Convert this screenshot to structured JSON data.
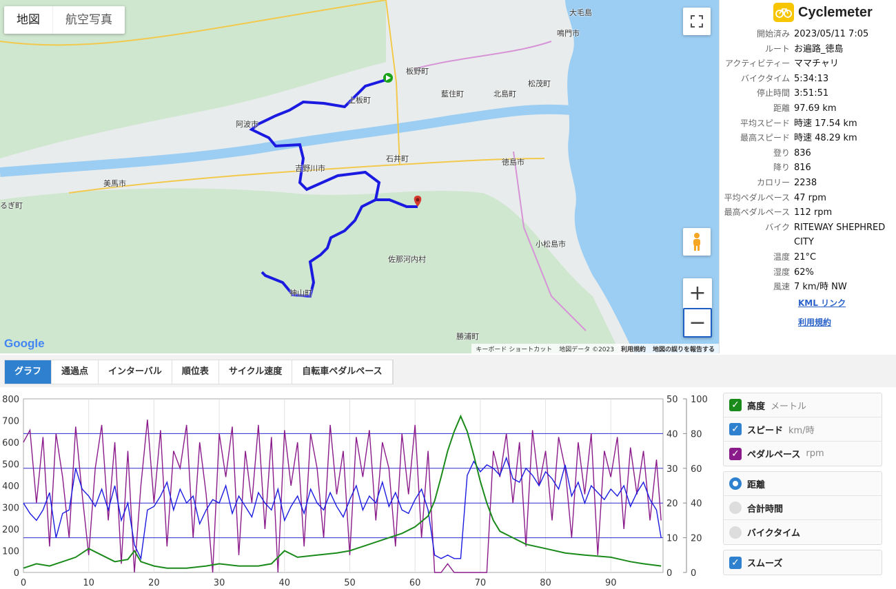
{
  "map": {
    "type_buttons": [
      "地図",
      "航空写真"
    ],
    "attribution": {
      "shortcuts": "キーボード ショートカット",
      "data": "地図データ ©2023",
      "terms": "利用規約",
      "report": "地図の誤りを報告する"
    },
    "google_logo": "Google",
    "place_labels": [
      "大毛島",
      "鳴門市",
      "板野町",
      "藍住町",
      "北島町",
      "松茂町",
      "上板町",
      "阿波市",
      "石井町",
      "吉野川市",
      "徳島市",
      "美馬市",
      "るぎ町",
      "佐那河内村",
      "小松島市",
      "神山町",
      "勝浦町"
    ],
    "route_color": "#1a1ae0"
  },
  "info": {
    "brand": "Cyclemeter",
    "brand_color": "#f7c600",
    "stats": [
      {
        "k": "開始済み",
        "v": "2023/05/11 7:05"
      },
      {
        "k": "ルート",
        "v": "お遍路_徳島"
      },
      {
        "k": "アクティビティー",
        "v": "ママチャリ"
      },
      {
        "k": "バイクタイム",
        "v": "5:34:13"
      },
      {
        "k": "停止時間",
        "v": "3:51:51"
      },
      {
        "k": "距離",
        "v": "97.69 km"
      },
      {
        "k": "平均スピード",
        "v": "時速 17.54 km"
      },
      {
        "k": "最高スピード",
        "v": "時速 48.29 km"
      },
      {
        "k": "登り",
        "v": "836"
      },
      {
        "k": "降り",
        "v": "816"
      },
      {
        "k": "カロリー",
        "v": "2238"
      },
      {
        "k": "平均ペダルペース",
        "v": "47 rpm"
      },
      {
        "k": "最高ペダルペース",
        "v": "112 rpm"
      },
      {
        "k": "バイク",
        "v": "RITEWAY SHEPHRED CITY"
      },
      {
        "k": "温度",
        "v": "21°C"
      },
      {
        "k": "湿度",
        "v": "62%"
      },
      {
        "k": "風速",
        "v": "7 km/時 NW"
      }
    ],
    "kml_link": "KML リンク",
    "terms_link": "利用規約"
  },
  "tabs": [
    {
      "label": "グラフ",
      "active": true
    },
    {
      "label": "通過点",
      "active": false
    },
    {
      "label": "インターバル",
      "active": false
    },
    {
      "label": "順位表",
      "active": false
    },
    {
      "label": "サイクル速度",
      "active": false
    },
    {
      "label": "自転車ペダルペース",
      "active": false
    }
  ],
  "legend": {
    "series": [
      {
        "label": "高度",
        "unit": "メートル",
        "color": "#1a8a1a",
        "checked": true
      },
      {
        "label": "スピード",
        "unit": "km/時",
        "color": "#2f81cf",
        "checked": true
      },
      {
        "label": "ペダルペース",
        "unit": "rpm",
        "color": "#8a1a8a",
        "checked": true
      }
    ],
    "x_modes": [
      {
        "label": "距離",
        "selected": true
      },
      {
        "label": "合計時間",
        "selected": false
      },
      {
        "label": "バイクタイム",
        "selected": false
      }
    ],
    "smooth": {
      "label": "スムーズ",
      "checked": true
    }
  },
  "chart_data": {
    "type": "line",
    "xlim": [
      0,
      98
    ],
    "x_ticks": [
      0,
      10,
      20,
      30,
      40,
      50,
      60,
      70,
      80,
      90
    ],
    "y_left": {
      "lim": [
        0,
        800
      ],
      "ticks": [
        0,
        100,
        200,
        300,
        400,
        500,
        600,
        700,
        800
      ]
    },
    "y_right1": {
      "lim": [
        0,
        50
      ],
      "ticks": [
        0,
        10,
        20,
        30,
        40,
        50
      ]
    },
    "y_right2": {
      "lim": [
        0,
        100
      ],
      "ticks": [
        0,
        20,
        40,
        60,
        80,
        100
      ]
    },
    "series": [
      {
        "color": "#1a8a1a",
        "axis": "left",
        "x": [
          0,
          2,
          4,
          6,
          8,
          10,
          12,
          14,
          16,
          17,
          18,
          20,
          22,
          25,
          28,
          30,
          33,
          36,
          38,
          40,
          42,
          45,
          48,
          50,
          53,
          56,
          58,
          60,
          62,
          63,
          64,
          65,
          66,
          67,
          68,
          69,
          70,
          71,
          72,
          73,
          75,
          77,
          80,
          83,
          86,
          90,
          93,
          95,
          97.7
        ],
        "values": [
          20,
          40,
          30,
          50,
          70,
          110,
          80,
          50,
          60,
          100,
          50,
          30,
          20,
          20,
          30,
          40,
          30,
          30,
          40,
          100,
          70,
          80,
          90,
          100,
          130,
          160,
          180,
          210,
          260,
          330,
          440,
          560,
          650,
          720,
          650,
          540,
          420,
          320,
          240,
          190,
          160,
          130,
          110,
          90,
          80,
          70,
          50,
          40,
          30
        ]
      },
      {
        "color": "#1a1ae0",
        "axis": "right1",
        "x": [
          0,
          1,
          2,
          3,
          4,
          5,
          6,
          7,
          8,
          9,
          10,
          11,
          12,
          13,
          14,
          15,
          16,
          17,
          18,
          19,
          20,
          21,
          22,
          23,
          24,
          25,
          26,
          27,
          28,
          29,
          30,
          31,
          32,
          33,
          34,
          35,
          36,
          37,
          38,
          39,
          40,
          41,
          42,
          43,
          44,
          45,
          46,
          47,
          48,
          49,
          50,
          51,
          52,
          53,
          54,
          55,
          56,
          57,
          58,
          59,
          60,
          61,
          62,
          63,
          64,
          65,
          66,
          67,
          68,
          69,
          70,
          71,
          72,
          73,
          74,
          75,
          76,
          77,
          78,
          79,
          80,
          81,
          82,
          83,
          84,
          85,
          86,
          87,
          88,
          89,
          90,
          91,
          92,
          93,
          94,
          95,
          96,
          97,
          97.7
        ],
        "values": [
          20,
          17,
          15,
          18,
          23,
          10,
          17,
          18,
          30,
          24,
          22,
          19,
          24,
          18,
          25,
          15,
          20,
          8,
          4,
          18,
          19,
          22,
          26,
          18,
          24,
          20,
          22,
          14,
          18,
          21,
          20,
          25,
          17,
          22,
          19,
          16,
          23,
          20,
          18,
          24,
          15,
          19,
          22,
          17,
          24,
          20,
          18,
          23,
          19,
          16,
          21,
          25,
          18,
          22,
          20,
          26,
          19,
          23,
          18,
          17,
          21,
          24,
          18,
          5,
          4,
          5,
          4,
          4,
          28,
          32,
          29,
          31,
          30,
          28,
          33,
          27,
          26,
          30,
          28,
          25,
          29,
          27,
          24,
          31,
          22,
          26,
          20,
          25,
          23,
          21,
          24,
          22,
          25,
          19,
          23,
          26,
          21,
          18,
          10
        ]
      },
      {
        "color": "#8a1a8a",
        "axis": "right2",
        "x": [
          0,
          1,
          2,
          3,
          4,
          5,
          6,
          7,
          8,
          9,
          10,
          11,
          12,
          13,
          14,
          15,
          16,
          17,
          18,
          19,
          20,
          21,
          22,
          23,
          24,
          25,
          26,
          27,
          28,
          29,
          30,
          31,
          32,
          33,
          34,
          35,
          36,
          37,
          38,
          39,
          40,
          41,
          42,
          43,
          44,
          45,
          46,
          47,
          48,
          49,
          50,
          51,
          52,
          53,
          54,
          55,
          56,
          57,
          58,
          59,
          60,
          61,
          62,
          63,
          64,
          65,
          66,
          67,
          68,
          69,
          70,
          71,
          72,
          73,
          74,
          75,
          76,
          77,
          78,
          79,
          80,
          81,
          82,
          83,
          84,
          85,
          86,
          87,
          88,
          89,
          90,
          91,
          92,
          93,
          94,
          95,
          96,
          97,
          97.7
        ],
        "values": [
          75,
          82,
          40,
          78,
          15,
          80,
          55,
          20,
          84,
          45,
          10,
          60,
          85,
          30,
          75,
          5,
          70,
          0,
          50,
          88,
          40,
          82,
          15,
          70,
          60,
          85,
          20,
          75,
          45,
          0,
          80,
          55,
          84,
          10,
          70,
          40,
          85,
          25,
          78,
          0,
          82,
          50,
          75,
          15,
          80,
          60,
          20,
          85,
          45,
          70,
          10,
          78,
          55,
          82,
          30,
          75,
          60,
          15,
          80,
          45,
          85,
          20,
          70,
          0,
          0,
          5,
          0,
          0,
          0,
          0,
          0,
          0,
          70,
          55,
          80,
          40,
          75,
          15,
          82,
          50,
          70,
          30,
          78,
          60,
          20,
          75,
          45,
          80,
          10,
          70,
          55,
          78,
          25,
          72,
          45,
          70,
          30,
          65,
          30
        ]
      }
    ]
  }
}
